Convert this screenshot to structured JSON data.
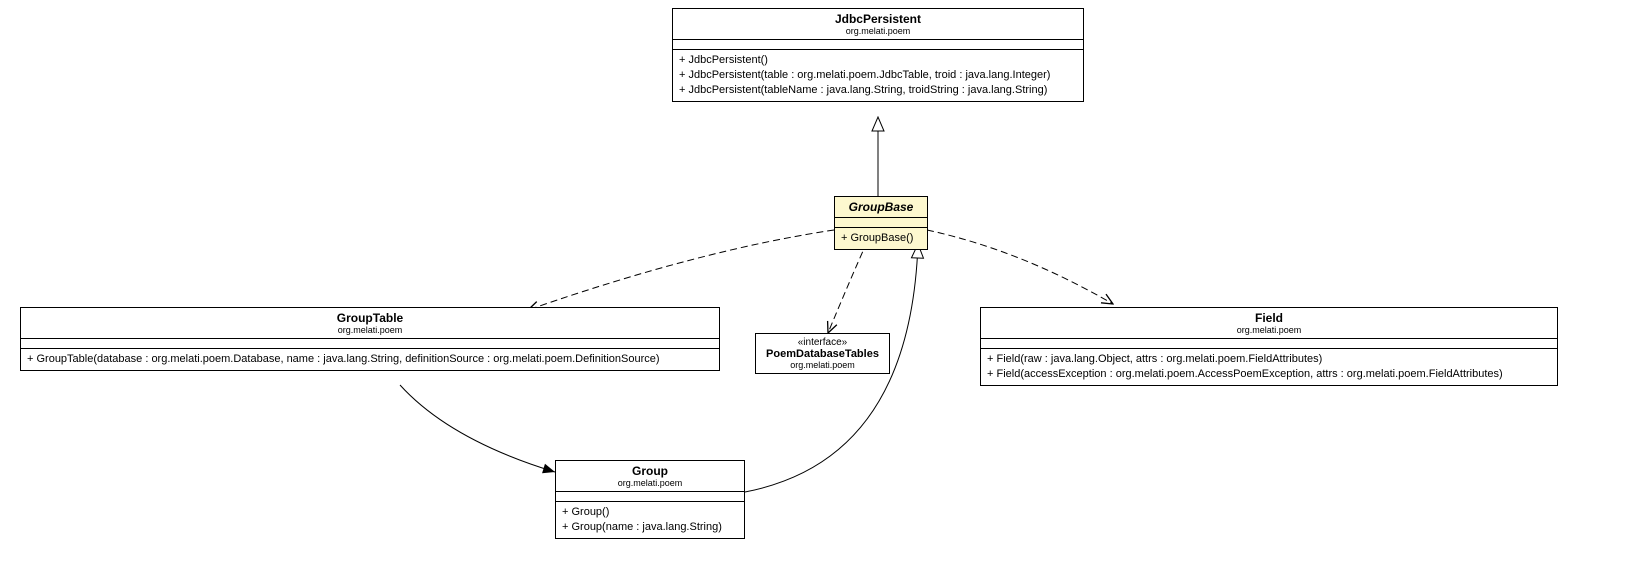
{
  "classes": {
    "jdbcPersistent": {
      "name": "JdbcPersistent",
      "package": "org.melati.poem",
      "ops": [
        "+ JdbcPersistent()",
        "+ JdbcPersistent(table : org.melati.poem.JdbcTable, troid : java.lang.Integer)",
        "+ JdbcPersistent(tableName : java.lang.String, troidString : java.lang.String)"
      ]
    },
    "groupBase": {
      "name": "GroupBase",
      "package": "",
      "ops": [
        "+ GroupBase()"
      ]
    },
    "groupTable": {
      "name": "GroupTable",
      "package": "org.melati.poem",
      "ops": [
        "+ GroupTable(database : org.melati.poem.Database, name : java.lang.String, definitionSource : org.melati.poem.DefinitionSource)"
      ]
    },
    "poemDatabaseTables": {
      "stereotype": "«interface»",
      "name": "PoemDatabaseTables",
      "package": "org.melati.poem"
    },
    "field": {
      "name": "Field",
      "package": "org.melati.poem",
      "ops": [
        "+ Field(raw : java.lang.Object, attrs : org.melati.poem.FieldAttributes)",
        "+ Field(accessException : org.melati.poem.AccessPoemException, attrs : org.melati.poem.FieldAttributes)"
      ]
    },
    "group": {
      "name": "Group",
      "package": "org.melati.poem",
      "ops": [
        "+ Group()",
        "+ Group(name : java.lang.String)"
      ]
    }
  }
}
